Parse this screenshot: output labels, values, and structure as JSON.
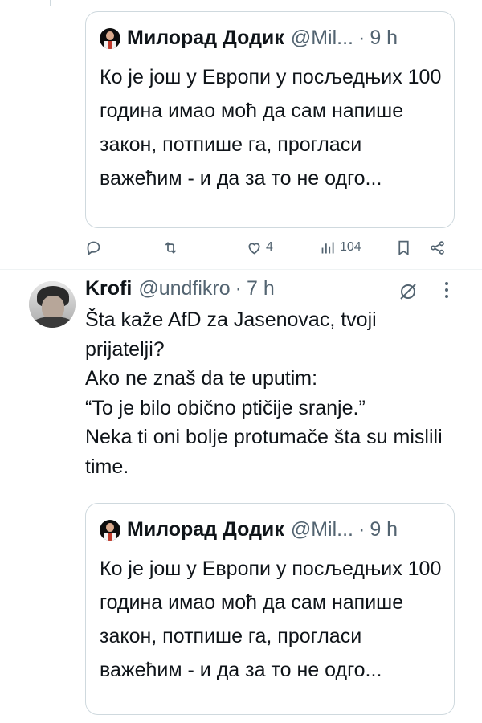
{
  "quoted_tweet": {
    "author_name": "Милорад Додик",
    "author_handle": "@Mil...",
    "dot": "·",
    "time": "9 h",
    "text": "Ко је још у Европи у посљедњих 100 година имао моћ да сам напише закон, потпише га, прогласи важећим - и да за то не одго..."
  },
  "actions": {
    "reply_icon": "reply-icon",
    "retweet_icon": "retweet-icon",
    "like_icon": "heart-icon",
    "like_count": "4",
    "views_icon": "views-icon",
    "views_count": "104",
    "bookmark_icon": "bookmark-icon",
    "share_icon": "share-icon"
  },
  "post": {
    "author_name": "Krofi",
    "author_handle": "@undfikro",
    "dot": "·",
    "time": "7 h",
    "text": "Šta kaže AfD za Jasenovac, tvoji prijatelji?\nAko ne znaš da te uputim:\n“To je bilo obično ptičije sranje.”\nNeka ti oni bolje protumače šta su mislili time."
  },
  "colors": {
    "text": "#0f1419",
    "secondary": "#536471",
    "border": "#cfd9de"
  }
}
